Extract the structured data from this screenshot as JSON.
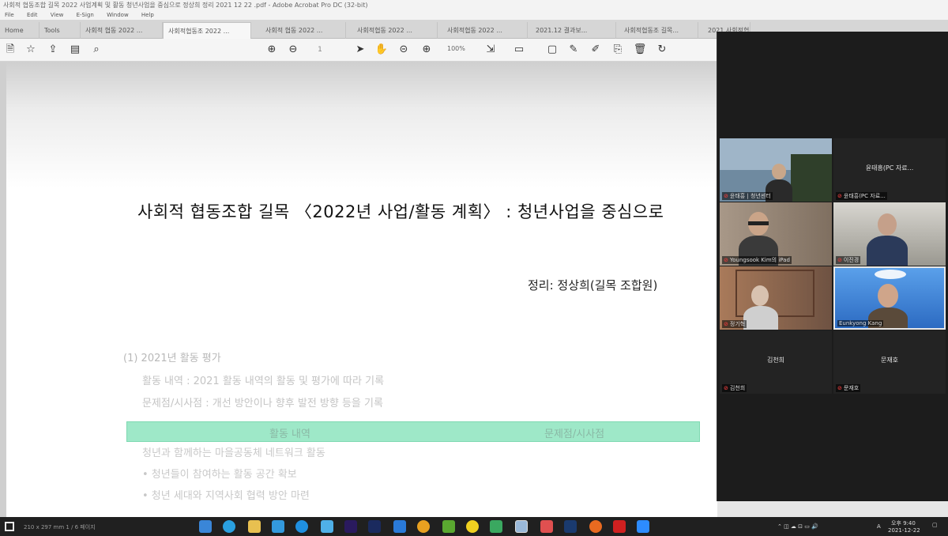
{
  "window": {
    "title": "사회적 협동조합 길목 2022 사업계획 및 활동 청년사업을 중심으로 정상희 정리 2021 12 22 .pdf - Adobe Acrobat Pro DC (32-bit)"
  },
  "menu": [
    "File",
    "Edit",
    "View",
    "E-Sign",
    "Window",
    "Help"
  ],
  "tabs": [
    {
      "label": "Home"
    },
    {
      "label": "Tools"
    },
    {
      "label": "사회적 협동 2022 ..."
    },
    {
      "label": "사회적협동조 2022 ..."
    },
    {
      "label": "사회적 협동 2022 ..."
    },
    {
      "label": "사회적협동 2022 ..."
    },
    {
      "label": "사회적협동 2022 ..."
    },
    {
      "label": "2021.12 결과보..."
    },
    {
      "label": "사회적협동조 길목..."
    },
    {
      "label": "2021 사회적협동..."
    }
  ],
  "toolbar": {
    "zoom": "100%",
    "page": "1"
  },
  "document": {
    "title": "사회적 협동조합 길목 〈2022년 사업/활동 계획〉 : 청년사업을 중심으로",
    "author": "정리: 정상희(길목 조합원)",
    "section_heading": "(1) 2021년 활동 평가",
    "lines": [
      "활동 내역 : 2021 활동 내역의 활동 및 평가에 따라 기록",
      "문제점/시사점 : 개선 방안이나 향후 발전 방향 등을 기록"
    ],
    "table_header": [
      "활동 내역",
      "문제점/시사점"
    ],
    "table_rows": [
      "청년과 함께하는 마을공동체 네트워크 활동",
      "• 청년들이 참여하는 활동 공간 확보",
      "• 청년 세대와 지역사회 협력 방안 마련"
    ]
  },
  "zoom_participants": [
    {
      "name": "윤태흥 | 청년센터",
      "has_video": true
    },
    {
      "name": "윤태흥(PC 자료...",
      "label": "윤태흥(PC 자료...",
      "has_video": false
    },
    {
      "name": "Youngsook Kim의 iPad",
      "has_video": true
    },
    {
      "name": "이진경",
      "has_video": true
    },
    {
      "name": "정기혁",
      "has_video": true
    },
    {
      "name": "Eunkyong Kang",
      "has_video": true
    },
    {
      "name": "김천희",
      "label": "김천희",
      "has_video": false
    },
    {
      "name": "문재호",
      "label": "문재호",
      "has_video": false
    }
  ],
  "taskbar": {
    "status_text": "210 x 297 mm  1 / 6  페이지",
    "time": "오후 9:40",
    "date": "2021-12-22",
    "lang": "A"
  },
  "colors": {
    "table_header_bg": "#9ee8c8",
    "zoom_bg": "#1c1c1c",
    "taskbar_bg": "#202020",
    "mic_muted": "#e23b3b",
    "active_speaker_border": "#e8e8e8"
  }
}
